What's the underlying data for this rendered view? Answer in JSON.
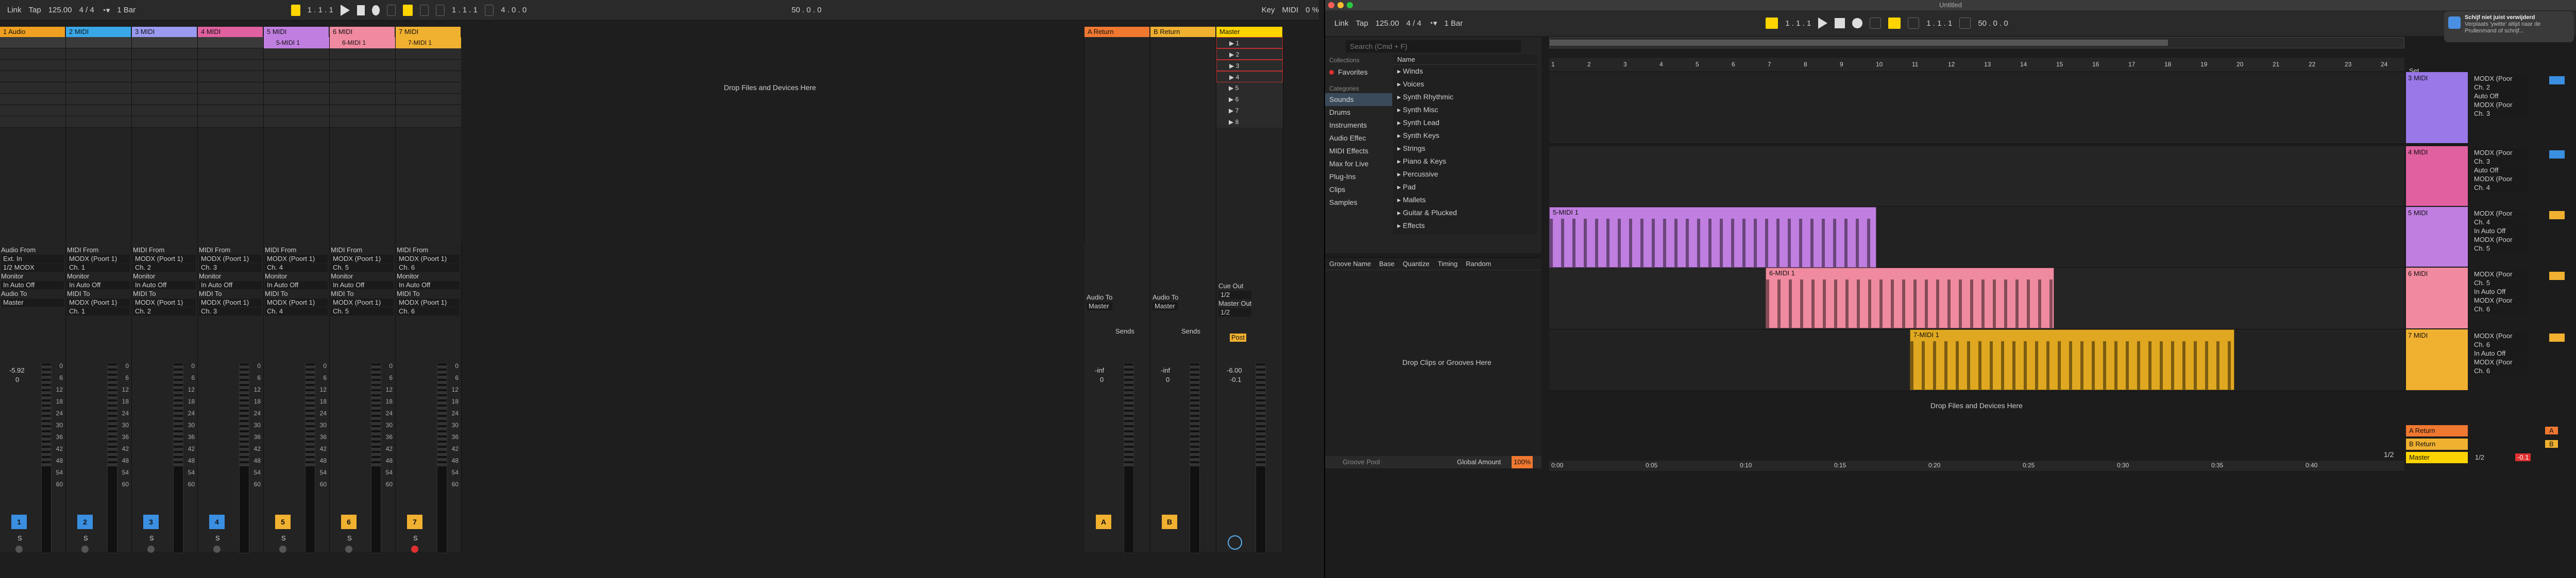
{
  "left_window": {
    "toolbar": {
      "link": "Link",
      "tap": "Tap",
      "tempo": "125.00",
      "signature": "4 / 4",
      "quantize": "1 Bar",
      "position": "1 .  1 .  1",
      "loop_pos": "1 .  1 .  1",
      "loop_len": "4 .  0 .  0",
      "key": "Key",
      "midi": "MIDI",
      "cpu": "0 %",
      "zoom": "50 .  0 .  0"
    },
    "tracks": [
      {
        "name": "1 Audio",
        "color": "#f0a020",
        "input_label": "Audio From",
        "input": "Ext. In",
        "channel": "1/2 MODX",
        "monitor": "Monitor",
        "monitor_val": "In  Auto  Off",
        "output_label": "Audio To",
        "output": "Master",
        "number": "1",
        "num_color": "#3a8fe0",
        "vol": "-5.92",
        "pan": "0"
      },
      {
        "name": "2 MIDI",
        "color": "#3aa8e8",
        "input_label": "MIDI From",
        "input": "MODX (Poort 1)",
        "channel": "Ch. 1",
        "monitor": "Monitor",
        "monitor_val": "In  Auto  Off",
        "output_label": "MIDI To",
        "output": "MODX (Poort 1)",
        "out_ch": "Ch. 1",
        "number": "2",
        "num_color": "#3a8fe0",
        "vol": "",
        "pan": ""
      },
      {
        "name": "3 MIDI",
        "color": "#9a9af0",
        "input_label": "MIDI From",
        "input": "MODX (Poort 1)",
        "channel": "Ch. 2",
        "monitor": "Monitor",
        "monitor_val": "In  Auto  Off",
        "output_label": "MIDI To",
        "output": "MODX (Poort 1)",
        "out_ch": "Ch. 2",
        "number": "3",
        "num_color": "#3a8fe0",
        "vol": "",
        "pan": ""
      },
      {
        "name": "4 MIDI",
        "color": "#e060a0",
        "input_label": "MIDI From",
        "input": "MODX (Poort 1)",
        "channel": "Ch. 3",
        "monitor": "Monitor",
        "monitor_val": "In  Auto  Off",
        "output_label": "MIDI To",
        "output": "MODX (Poort 1)",
        "out_ch": "Ch. 3",
        "number": "4",
        "num_color": "#3a8fe0",
        "vol": "",
        "pan": ""
      },
      {
        "name": "5 MIDI",
        "color": "#c07ee0",
        "input_label": "MIDI From",
        "input": "MODX (Poort 1)",
        "channel": "Ch. 4",
        "monitor": "Monitor",
        "monitor_val": "In  Auto  Off",
        "output_label": "MIDI To",
        "output": "MODX (Poort 1)",
        "out_ch": "Ch. 4",
        "number": "5",
        "num_color": "#f0b030",
        "vol": "",
        "pan": "",
        "clip": "5-MIDI 1"
      },
      {
        "name": "6 MIDI",
        "color": "#f08aa0",
        "input_label": "MIDI From",
        "input": "MODX (Poort 1)",
        "channel": "Ch. 5",
        "monitor": "Monitor",
        "monitor_val": "In  Auto  Off",
        "output_label": "MIDI To",
        "output": "MODX (Poort 1)",
        "out_ch": "Ch. 5",
        "number": "6",
        "num_color": "#f0b030",
        "vol": "",
        "pan": "",
        "clip": "6-MIDI 1"
      },
      {
        "name": "7 MIDI",
        "color": "#f0b030",
        "input_label": "MIDI From",
        "input": "MODX (Poort 1)",
        "channel": "Ch. 6",
        "monitor": "Monitor",
        "monitor_val": "In  Auto  Off",
        "output_label": "MIDI To",
        "output": "MODX (Poort 1)",
        "out_ch": "Ch. 6",
        "number": "7",
        "num_color": "#f0b030",
        "vol": "",
        "pan": "",
        "clip": "7-MIDI 1"
      }
    ],
    "drop_text": "Drop Files and Devices Here",
    "returns": [
      {
        "name": "A Return",
        "color": "#f07830",
        "output_label": "Audio To",
        "output": "Master",
        "number": "A",
        "vol": "-inf",
        "pan": "0"
      },
      {
        "name": "B Return",
        "color": "#f0b030",
        "output_label": "Audio To",
        "output": "Master",
        "number": "B",
        "vol": "-inf",
        "pan": "0"
      }
    ],
    "master": {
      "name": "Master",
      "color": "#ffd400",
      "cue_label": "Cue Out",
      "cue": "1/2",
      "out_label": "Master Out",
      "out": "1/2",
      "vol": "-6.00",
      "pan": "-0.1",
      "scenes": [
        "1",
        "2",
        "3",
        "4",
        "5",
        "6",
        "7",
        "8"
      ],
      "post": "Post"
    },
    "sends_label": "Sends",
    "meter_scale": [
      "0",
      "6",
      "12",
      "18",
      "24",
      "30",
      "36",
      "42",
      "48",
      "54",
      "60"
    ],
    "ab": [
      "A",
      "B"
    ]
  },
  "right_window": {
    "title": "Untitled",
    "toolbar": {
      "link": "Link",
      "tap": "Tap",
      "tempo": "125.00",
      "signature": "4 / 4",
      "quantize": "1 Bar",
      "position": "1 .  1 .  1",
      "loop_pos": "1 .  1 .  1",
      "zoom": "50 .  0 .  0"
    },
    "browser": {
      "search_placeholder": "Search (Cmd + F)",
      "collections_label": "Collections",
      "favorites": "Favorites",
      "categories_label": "Categories",
      "categories": [
        "Sounds",
        "Drums",
        "Instruments",
        "Audio Effec",
        "MIDI Effects",
        "Max for Live",
        "Plug-Ins",
        "Clips",
        "Samples"
      ],
      "name_header": "Name",
      "items": [
        "Winds",
        "Voices",
        "Synth Rhythmic",
        "Synth Misc",
        "Synth Lead",
        "Synth Keys",
        "Strings",
        "Piano & Keys",
        "Percussive",
        "Pad",
        "Mallets",
        "Guitar & Plucked",
        "Effects"
      ]
    },
    "groove": {
      "headers": [
        "Groove Name",
        "Base",
        "Quantize",
        "Timing",
        "Random"
      ],
      "drop": "Drop Clips or Grooves Here",
      "pool": "Groove Pool",
      "global_label": "Global Amount",
      "global_val": "100%"
    },
    "ruler": [
      "1",
      "2",
      "3",
      "4",
      "5",
      "6",
      "7",
      "8",
      "9",
      "10",
      "11",
      "12",
      "13",
      "14",
      "15",
      "16",
      "17",
      "18",
      "19",
      "20",
      "21",
      "22",
      "23",
      "24"
    ],
    "times": [
      "0:00",
      "0:05",
      "0:10",
      "0:15",
      "0:20",
      "0:25",
      "0:30",
      "0:35",
      "0:40"
    ],
    "set_label": "Set",
    "clips": [
      {
        "name": "5-MIDI 1"
      },
      {
        "name": "6-MIDI 1"
      },
      {
        "name": "7-MIDI 1"
      }
    ],
    "drop_text": "Drop Files and Devices Here",
    "mixer": [
      {
        "name": "3 MIDI",
        "input": "MODX (Poor",
        "channel": "Ch. 2",
        "monitor": "Auto  Off",
        "out": "MODX (Poor",
        "out_ch": "Ch. 3"
      },
      {
        "name": "4 MIDI",
        "input": "MODX (Poor",
        "channel": "Ch. 3",
        "monitor": "Auto  Off",
        "out": "MODX (Poor",
        "out_ch": "Ch. 4"
      },
      {
        "name": "5 MIDI",
        "input": "MODX (Poor",
        "channel": "Ch. 4",
        "monitor": "In  Auto  Off",
        "out": "MODX (Poor",
        "out_ch": "Ch. 5"
      },
      {
        "name": "6 MIDI",
        "input": "MODX (Poor",
        "channel": "Ch. 5",
        "monitor": "In  Auto  Off",
        "out": "MODX (Poor",
        "out_ch": "Ch. 6"
      },
      {
        "name": "7 MIDI",
        "input": "MODX (Poor",
        "channel": "Ch. 6",
        "monitor": "In  Auto  Off",
        "out": "MODX (Poor",
        "out_ch": "Ch. 6"
      }
    ],
    "returns": [
      {
        "name": "A Return",
        "letter": "A"
      },
      {
        "name": "B Return",
        "letter": "B"
      },
      {
        "name": "Master",
        "out": "1/2",
        "vol": "-0.1"
      }
    ],
    "page": "1/2",
    "notification": {
      "title": "Schijf niet juist verwijderd",
      "body": "Verplaats 'ywitte' altijd naar de Prullenmand of schrijf..."
    }
  }
}
